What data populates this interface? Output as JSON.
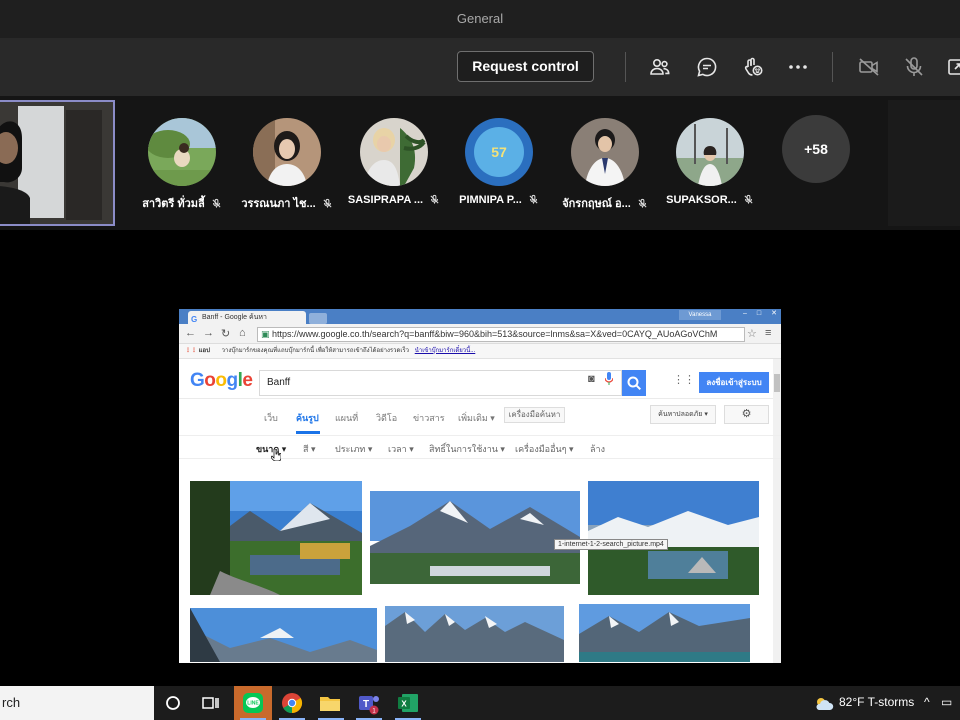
{
  "window": {
    "title": "General"
  },
  "toolbar": {
    "request_control": "Request control",
    "icons": [
      "people-icon",
      "chat-icon",
      "reactions-icon",
      "more-options-icon",
      "camera-off-icon",
      "mic-off-icon",
      "share-tray-icon"
    ]
  },
  "participants": [
    {
      "name": "สาวิตรี ทั่วมลี้",
      "avatar": "photo"
    },
    {
      "name": "วรรณนภา ไช...",
      "avatar": "photo"
    },
    {
      "name": "SASIPRAPA ...",
      "avatar": "photo"
    },
    {
      "name": "PIMNIPA P...",
      "avatar": "initials",
      "initials": "57",
      "color": "#2b6fbf"
    },
    {
      "name": "จักรกฤษณ์ อ...",
      "avatar": "photo"
    },
    {
      "name": "SUPAKSOR...",
      "avatar": "photo"
    }
  ],
  "more_participants": "+58",
  "shared_screen": {
    "browser": {
      "tab_title": "Banff - Google ค้นหา",
      "profile": "Vanessa",
      "url": "https://www.google.co.th/search?q=banff&biw=960&bih=513&source=lnms&sa=X&ved=0CAYQ_AUoAGoVChM",
      "bookmarks_label": "แอป",
      "bookmark_text": "วางบุ๊กมาร์กของคุณที่แถบบุ๊กมาร์กนี้ เพื่อให้สามารถเข้าถึงได้อย่างรวดเร็ว",
      "bookmark_link": "นำเข้าบุ๊กมาร์กเดี๋ยวนี้..."
    },
    "google": {
      "logo": "Google",
      "query": "Banff",
      "signin": "ลงชื่อเข้าสู่ระบบ",
      "tabs": [
        "เว็บ",
        "ค้นรูป",
        "แผนที่",
        "วิดีโอ",
        "ข่าวสาร",
        "เพิ่มเติม ▾"
      ],
      "tools": "เครื่องมือค้นหา",
      "safesearch": "ค้นหาปลอดภัย ▾",
      "filters": [
        "ขนาด",
        "สี",
        "ประเภท",
        "เวลา",
        "สิทธิ์ในการใช้งาน",
        "เครื่องมืออื่นๆ",
        "ล้าง"
      ]
    },
    "tooltip": "1-internet-1-2-search_picture.mp4"
  },
  "taskbar": {
    "search_text": "rch",
    "weather": "82°F  T-storms"
  },
  "colors": {
    "accent": "#8b8cc7",
    "google_blue": "#4285f4",
    "line_orange": "#c96a2c"
  }
}
